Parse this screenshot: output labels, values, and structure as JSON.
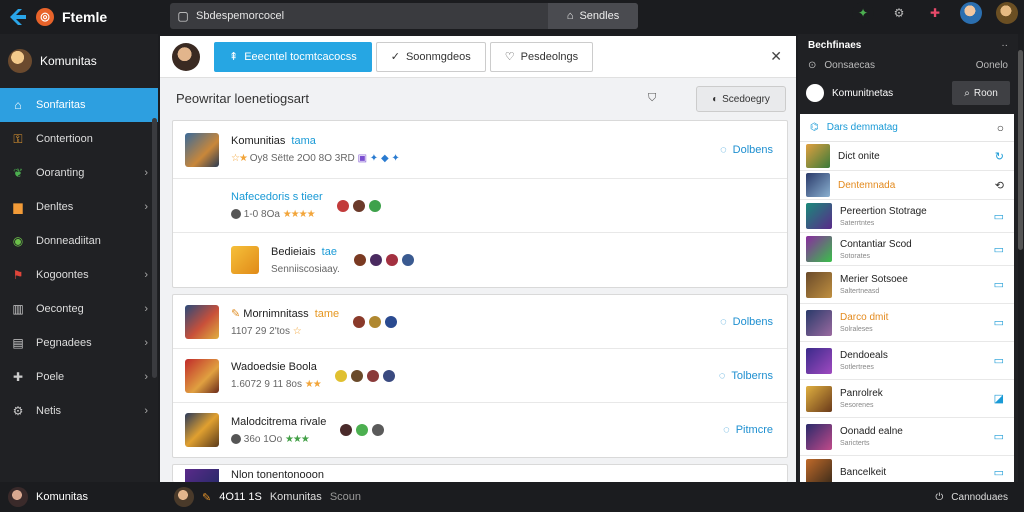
{
  "app": {
    "title": "Ftemle"
  },
  "search": {
    "value": "Sbdespemorcocel",
    "button_label": "Sendles"
  },
  "sidebar": {
    "header": "Komunitas",
    "items": [
      {
        "label": "Sonfaritas",
        "active": true
      },
      {
        "label": "Contertioon"
      },
      {
        "label": "Ooranting"
      },
      {
        "label": "Denltes"
      },
      {
        "label": "Donneadiitan"
      },
      {
        "label": "Kogoontes"
      },
      {
        "label": "Oeconteg"
      },
      {
        "label": "Pegnadees"
      },
      {
        "label": "Poele"
      },
      {
        "label": "Netis"
      }
    ]
  },
  "tabs": [
    {
      "label": "Eeecntel tocmtcacocss",
      "active": true
    },
    {
      "label": "Soonmgdeos"
    },
    {
      "label": "Pesdeolngs"
    }
  ],
  "toolbar": {
    "title": "Peowritar loenetiogsart",
    "button_label": "Scedoegry"
  },
  "card1": [
    {
      "title": "Komunitias",
      "tag": "tama",
      "meta": "Oy8 Sëtte 2O0 8O 3RD",
      "follow": "Dolbens"
    },
    {
      "title": "Nafecedoris s tieer",
      "meta": "1-0 8Oa",
      "sub": true
    },
    {
      "title": "Bedieiais",
      "tag": "tae",
      "meta": "Senniiscosiaay.",
      "sub": true
    }
  ],
  "card2": [
    {
      "title": "Mornimnitass",
      "tag": "tame",
      "meta": "1107 29 2'tos",
      "follow": "Dolbens"
    },
    {
      "title": "Wadoedsie Boola",
      "meta": "1.6072 9 11 8os",
      "follow": "Tolberns"
    },
    {
      "title": "Malodcitrema rivale",
      "meta": "36o 1Oo",
      "follow": "Pitmcre"
    }
  ],
  "partial_row": {
    "title": "Nlon tonentonooon"
  },
  "right_panel": {
    "title": "Bechfinaes",
    "more": "··",
    "sub_left": "Oonsaecas",
    "sub_right": "Oonelo",
    "bar_label": "Komunitnetas",
    "bar_button": "Roon",
    "list_header": "Dars demmatag",
    "items": [
      {
        "name": "Dict onite",
        "meta": ""
      },
      {
        "name": "Dentemnada",
        "meta": "",
        "orange": true
      },
      {
        "name": "Pereertion Stotrage",
        "meta": "Saterrtntes"
      },
      {
        "name": "Contantiar Scod",
        "meta": "Sotorates"
      },
      {
        "name": "Merier Sotsoee",
        "meta": "Saltertneasd"
      },
      {
        "name": "Darco dmit",
        "meta": "Solraleses",
        "orange": true
      },
      {
        "name": "Dendoeals",
        "meta": "Sotlertrees"
      },
      {
        "name": "Panrolrek",
        "meta": "Sesorenes"
      },
      {
        "name": "Oonadd ealne",
        "meta": "Saricterts"
      },
      {
        "name": "Bancelkeit",
        "meta": ""
      }
    ]
  },
  "bottom": {
    "left_label": "Komunitas",
    "count": "4O11 1S",
    "label": "Komunitas",
    "tag": "Scoun",
    "right_label": "Cannoduaes"
  },
  "colors": {
    "accent": "#2d9fe0",
    "sidebar_bg": "#202124",
    "topbar_bg": "#1b1c1f"
  }
}
